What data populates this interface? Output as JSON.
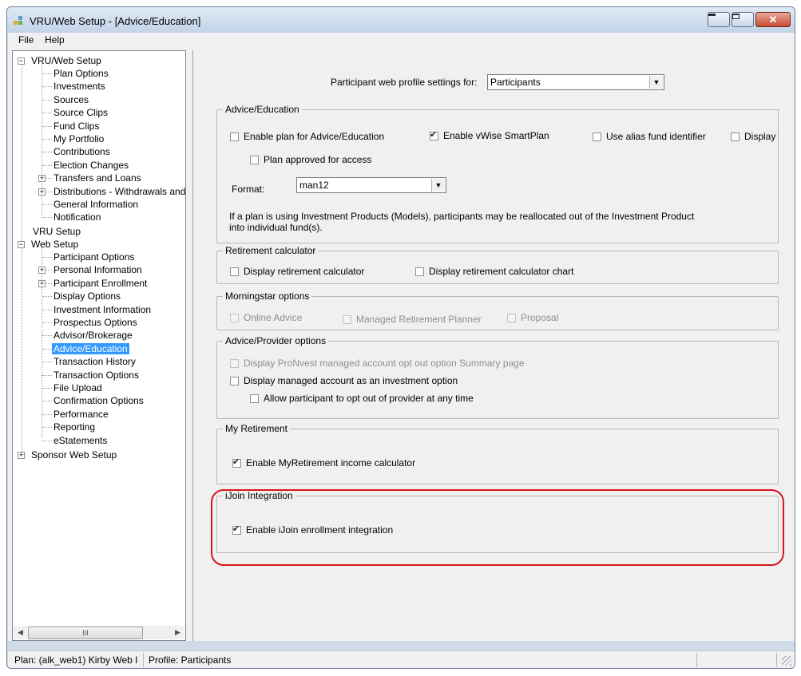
{
  "window": {
    "title": "VRU/Web Setup - [Advice/Education]",
    "icon": "app-window-icon",
    "min_icon": "minimize-icon",
    "max_icon": "maximize-icon",
    "close_glyph": "✕"
  },
  "menubar": {
    "file": "File",
    "help": "Help"
  },
  "tree": {
    "root": "VRU/Web Setup",
    "vru_web_children": [
      "Plan Options",
      "Investments",
      "Sources",
      "Source Clips",
      "Fund Clips",
      "My Portfolio",
      "Contributions",
      "Election Changes",
      "Transfers and Loans",
      "Distributions - Withdrawals and T",
      "General Information",
      "Notification"
    ],
    "vru_setup": "VRU Setup",
    "web_setup": "Web Setup",
    "web_setup_children": [
      "Participant Options",
      "Personal Information",
      "Participant Enrollment",
      "Display Options",
      "Investment Information",
      "Prospectus Options",
      "Advisor/Brokerage",
      "Advice/Education",
      "Transaction History",
      "Transaction Options",
      "File Upload",
      "Confirmation Options",
      "Performance",
      "Reporting",
      "eStatements"
    ],
    "sponsor": "Sponsor Web Setup",
    "scroll_thumb": "III"
  },
  "profile": {
    "label": "Participant web profile settings for:",
    "value": "Participants"
  },
  "advice_education": {
    "title": "Advice/Education",
    "enable_plan": "Enable plan for Advice/Education",
    "enable_vwise": "Enable vWise SmartPlan",
    "use_alias": "Use alias fund identifier",
    "display": "Display",
    "plan_approved": "Plan approved for access",
    "format_label": "Format:",
    "format_value": "man12",
    "info": "If a plan is using Investment Products (Models), participants may be reallocated out of the Investment Product into individual fund(s)."
  },
  "retirement_calculator": {
    "title": "Retirement calculator",
    "display_calc": "Display retirement calculator",
    "display_chart": "Display retirement calculator chart"
  },
  "morningstar": {
    "title": "Morningstar options",
    "online_advice": "Online Advice",
    "managed_planner": "Managed Retirement Planner",
    "proposal": "Proposal"
  },
  "advice_provider": {
    "title": "Advice/Provider options",
    "pronvest": "Display ProNvest managed account opt out option Summary page",
    "managed_investment": "Display managed account as an investment option",
    "allow_opt_out": "Allow participant to opt out of provider at any time"
  },
  "my_retirement": {
    "title": "My Retirement",
    "enable": "Enable MyRetirement income calculator"
  },
  "ijoin": {
    "title": "iJoin Integration",
    "enable": "Enable iJoin enrollment integration"
  },
  "status": {
    "plan": "Plan: (alk_web1) Kirby Web I",
    "profile": "Profile: Participants"
  },
  "colors": {
    "selection": "#3399ff",
    "highlight_ring": "#d9141a",
    "titlebar": "#c2d3e8"
  }
}
